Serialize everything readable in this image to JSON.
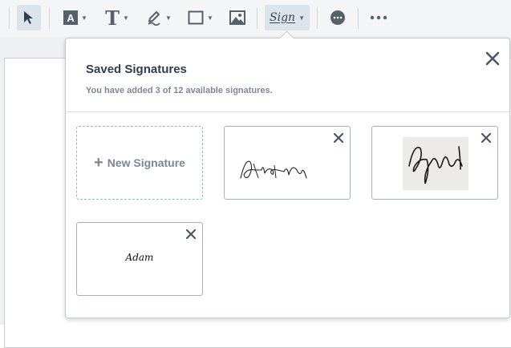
{
  "toolbar": {
    "tools": [
      {
        "name": "select-tool",
        "icon": "cursor-arrow-icon",
        "active": true
      },
      {
        "name": "font-tool",
        "icon": "font-box-icon",
        "glyph": "A"
      },
      {
        "name": "text-tool",
        "icon": "text-t-icon",
        "glyph": "T"
      },
      {
        "name": "highlight-tool",
        "icon": "pen-icon"
      },
      {
        "name": "shape-tool",
        "icon": "rectangle-icon"
      },
      {
        "name": "image-tool",
        "icon": "image-icon"
      },
      {
        "name": "sign-tool",
        "icon": "signature-icon",
        "label": "Sign",
        "active": true
      },
      {
        "name": "comment-tool",
        "icon": "chat-bubble-icon"
      },
      {
        "name": "more-tool",
        "icon": "more-dots-icon"
      }
    ],
    "colors": {
      "bar": "#f4f5f7",
      "active": "#dde3ea",
      "icon": "#56606a"
    }
  },
  "signatures_panel": {
    "title": "Saved Signatures",
    "subtitle": "You have added 3 of 12 available signatures.",
    "new_signature_label": "New Signature",
    "signatures": [
      {
        "type": "drawn",
        "description": "handwritten scribble"
      },
      {
        "type": "image",
        "description": "scanned signature"
      },
      {
        "type": "typed",
        "text": "Adam"
      }
    ]
  }
}
